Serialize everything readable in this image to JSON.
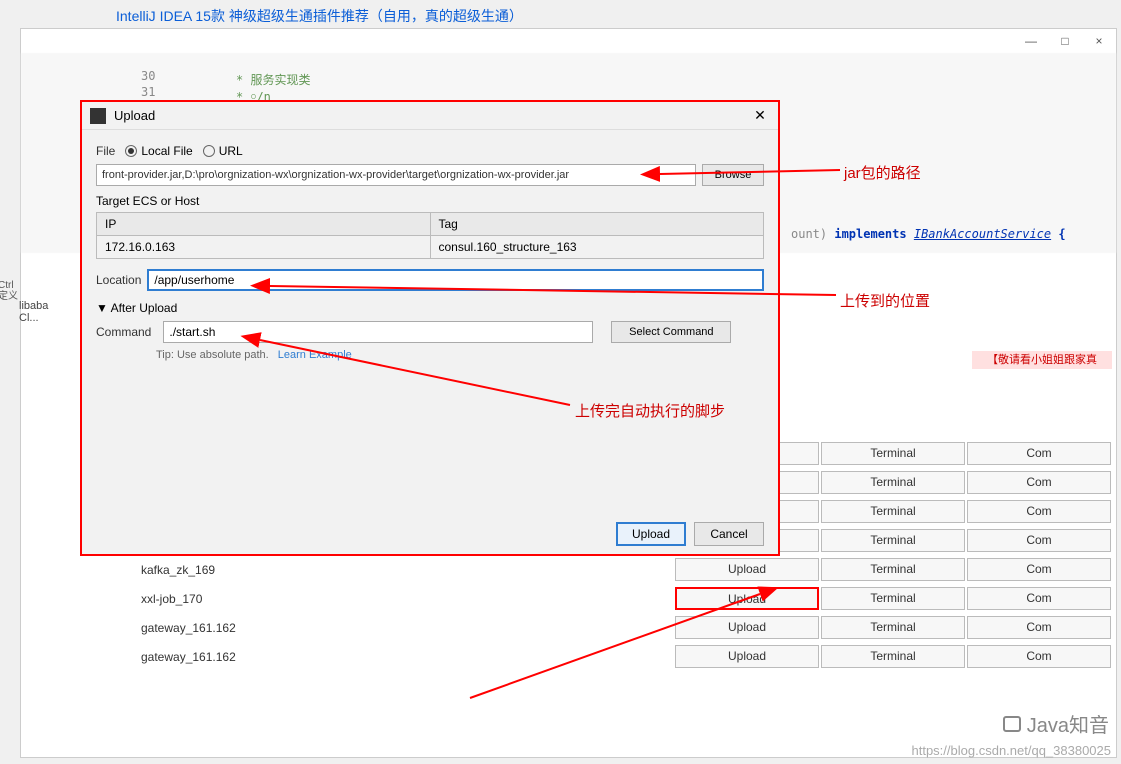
{
  "top_link": "IntelliJ IDEA 15款 神级超级生通插件推荐（自用，真的超级生通）",
  "window": {
    "min": "—",
    "max": "□",
    "close": "×"
  },
  "code": {
    "line_nums": [
      "30",
      "31"
    ],
    "comment1": "*  服务实现类",
    "comment2": "*  ￮/n",
    "right_part1": "ount)",
    "right_part2": "implements",
    "right_part3": "IBankAccountService",
    "right_brace": "{"
  },
  "ad_pink": "【敬请看小姐姐跟家真",
  "side_ctrl": "Ctrl\n定义",
  "side_aliba": "libaba Cl...",
  "dialog": {
    "title": "Upload",
    "file_label": "File",
    "radio_local": "Local File",
    "radio_url": "URL",
    "file_value": "front-provider.jar,D:\\pro\\orgnization-wx\\orgnization-wx-provider\\target\\orgnization-wx-provider.jar",
    "browse": "Browse",
    "target_label": "Target ECS or Host",
    "ip_header": "IP",
    "tag_header": "Tag",
    "ip_value": "172.16.0.163",
    "tag_value": "consul.160_structure_163",
    "location_label": "Location",
    "location_value": "/app/userhome",
    "after_label": "After Upload",
    "command_label": "Command",
    "command_value": "./start.sh",
    "select_cmd": "Select Command",
    "tip": "Tip: Use absolute path.",
    "learn": "Learn Example",
    "upload_btn": "Upload",
    "cancel_btn": "Cancel"
  },
  "bg_rows": [
    {
      "name": ""
    },
    {
      "name": ""
    },
    {
      "name": ""
    },
    {
      "name": ""
    },
    {
      "name": "kafka_zk_169"
    },
    {
      "name": "xxl-job_170"
    },
    {
      "name": "gateway_161.162"
    },
    {
      "name": "gateway_161.162"
    }
  ],
  "bg_cols": {
    "upload": "Upload",
    "terminal": "Terminal",
    "command": "Com"
  },
  "annotations": {
    "a1": "jar包的路径",
    "a2": "上传到的位置",
    "a3": "上传完自动执行的脚步"
  },
  "watermark": {
    "text": "Java知音",
    "url": "https://blog.csdn.net/qq_38380025"
  }
}
